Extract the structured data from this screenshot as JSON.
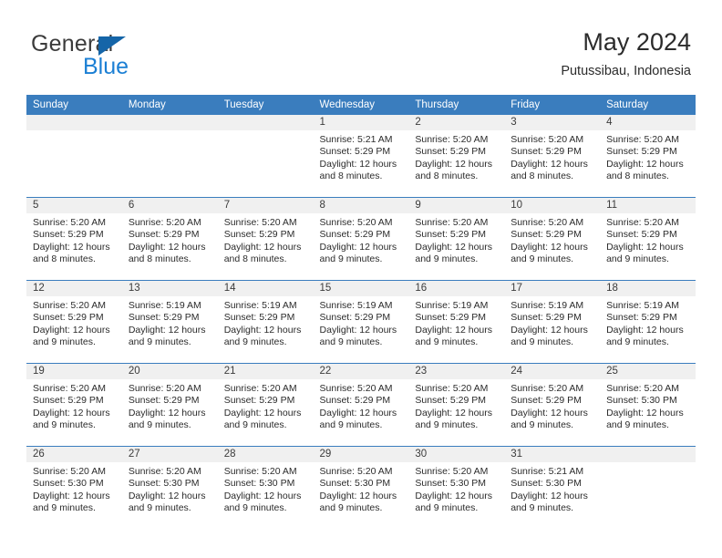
{
  "brand": {
    "name_part1": "General",
    "name_part2": "Blue",
    "triangle_icon": "triangle-icon",
    "accent_blue": "#1b7fd4",
    "logo_triangle_blue": "#1565a8"
  },
  "header": {
    "title": "May 2024",
    "subtitle": "Putussibau, Indonesia"
  },
  "colors": {
    "header_row_bg": "#3a7dbe",
    "header_row_text": "#ffffff",
    "daynum_band_bg": "#f0f0f0",
    "row_separator": "#3a7dbe",
    "body_text": "#2b2b2b"
  },
  "weekday_headers": [
    "Sunday",
    "Monday",
    "Tuesday",
    "Wednesday",
    "Thursday",
    "Friday",
    "Saturday"
  ],
  "weeks": [
    [
      {
        "day": "",
        "sunrise": "",
        "sunset": "",
        "daylight_line1": "",
        "daylight_line2": ""
      },
      {
        "day": "",
        "sunrise": "",
        "sunset": "",
        "daylight_line1": "",
        "daylight_line2": ""
      },
      {
        "day": "",
        "sunrise": "",
        "sunset": "",
        "daylight_line1": "",
        "daylight_line2": ""
      },
      {
        "day": "1",
        "sunrise": "Sunrise: 5:21 AM",
        "sunset": "Sunset: 5:29 PM",
        "daylight_line1": "Daylight: 12 hours",
        "daylight_line2": "and 8 minutes."
      },
      {
        "day": "2",
        "sunrise": "Sunrise: 5:20 AM",
        "sunset": "Sunset: 5:29 PM",
        "daylight_line1": "Daylight: 12 hours",
        "daylight_line2": "and 8 minutes."
      },
      {
        "day": "3",
        "sunrise": "Sunrise: 5:20 AM",
        "sunset": "Sunset: 5:29 PM",
        "daylight_line1": "Daylight: 12 hours",
        "daylight_line2": "and 8 minutes."
      },
      {
        "day": "4",
        "sunrise": "Sunrise: 5:20 AM",
        "sunset": "Sunset: 5:29 PM",
        "daylight_line1": "Daylight: 12 hours",
        "daylight_line2": "and 8 minutes."
      }
    ],
    [
      {
        "day": "5",
        "sunrise": "Sunrise: 5:20 AM",
        "sunset": "Sunset: 5:29 PM",
        "daylight_line1": "Daylight: 12 hours",
        "daylight_line2": "and 8 minutes."
      },
      {
        "day": "6",
        "sunrise": "Sunrise: 5:20 AM",
        "sunset": "Sunset: 5:29 PM",
        "daylight_line1": "Daylight: 12 hours",
        "daylight_line2": "and 8 minutes."
      },
      {
        "day": "7",
        "sunrise": "Sunrise: 5:20 AM",
        "sunset": "Sunset: 5:29 PM",
        "daylight_line1": "Daylight: 12 hours",
        "daylight_line2": "and 8 minutes."
      },
      {
        "day": "8",
        "sunrise": "Sunrise: 5:20 AM",
        "sunset": "Sunset: 5:29 PM",
        "daylight_line1": "Daylight: 12 hours",
        "daylight_line2": "and 9 minutes."
      },
      {
        "day": "9",
        "sunrise": "Sunrise: 5:20 AM",
        "sunset": "Sunset: 5:29 PM",
        "daylight_line1": "Daylight: 12 hours",
        "daylight_line2": "and 9 minutes."
      },
      {
        "day": "10",
        "sunrise": "Sunrise: 5:20 AM",
        "sunset": "Sunset: 5:29 PM",
        "daylight_line1": "Daylight: 12 hours",
        "daylight_line2": "and 9 minutes."
      },
      {
        "day": "11",
        "sunrise": "Sunrise: 5:20 AM",
        "sunset": "Sunset: 5:29 PM",
        "daylight_line1": "Daylight: 12 hours",
        "daylight_line2": "and 9 minutes."
      }
    ],
    [
      {
        "day": "12",
        "sunrise": "Sunrise: 5:20 AM",
        "sunset": "Sunset: 5:29 PM",
        "daylight_line1": "Daylight: 12 hours",
        "daylight_line2": "and 9 minutes."
      },
      {
        "day": "13",
        "sunrise": "Sunrise: 5:19 AM",
        "sunset": "Sunset: 5:29 PM",
        "daylight_line1": "Daylight: 12 hours",
        "daylight_line2": "and 9 minutes."
      },
      {
        "day": "14",
        "sunrise": "Sunrise: 5:19 AM",
        "sunset": "Sunset: 5:29 PM",
        "daylight_line1": "Daylight: 12 hours",
        "daylight_line2": "and 9 minutes."
      },
      {
        "day": "15",
        "sunrise": "Sunrise: 5:19 AM",
        "sunset": "Sunset: 5:29 PM",
        "daylight_line1": "Daylight: 12 hours",
        "daylight_line2": "and 9 minutes."
      },
      {
        "day": "16",
        "sunrise": "Sunrise: 5:19 AM",
        "sunset": "Sunset: 5:29 PM",
        "daylight_line1": "Daylight: 12 hours",
        "daylight_line2": "and 9 minutes."
      },
      {
        "day": "17",
        "sunrise": "Sunrise: 5:19 AM",
        "sunset": "Sunset: 5:29 PM",
        "daylight_line1": "Daylight: 12 hours",
        "daylight_line2": "and 9 minutes."
      },
      {
        "day": "18",
        "sunrise": "Sunrise: 5:19 AM",
        "sunset": "Sunset: 5:29 PM",
        "daylight_line1": "Daylight: 12 hours",
        "daylight_line2": "and 9 minutes."
      }
    ],
    [
      {
        "day": "19",
        "sunrise": "Sunrise: 5:20 AM",
        "sunset": "Sunset: 5:29 PM",
        "daylight_line1": "Daylight: 12 hours",
        "daylight_line2": "and 9 minutes."
      },
      {
        "day": "20",
        "sunrise": "Sunrise: 5:20 AM",
        "sunset": "Sunset: 5:29 PM",
        "daylight_line1": "Daylight: 12 hours",
        "daylight_line2": "and 9 minutes."
      },
      {
        "day": "21",
        "sunrise": "Sunrise: 5:20 AM",
        "sunset": "Sunset: 5:29 PM",
        "daylight_line1": "Daylight: 12 hours",
        "daylight_line2": "and 9 minutes."
      },
      {
        "day": "22",
        "sunrise": "Sunrise: 5:20 AM",
        "sunset": "Sunset: 5:29 PM",
        "daylight_line1": "Daylight: 12 hours",
        "daylight_line2": "and 9 minutes."
      },
      {
        "day": "23",
        "sunrise": "Sunrise: 5:20 AM",
        "sunset": "Sunset: 5:29 PM",
        "daylight_line1": "Daylight: 12 hours",
        "daylight_line2": "and 9 minutes."
      },
      {
        "day": "24",
        "sunrise": "Sunrise: 5:20 AM",
        "sunset": "Sunset: 5:29 PM",
        "daylight_line1": "Daylight: 12 hours",
        "daylight_line2": "and 9 minutes."
      },
      {
        "day": "25",
        "sunrise": "Sunrise: 5:20 AM",
        "sunset": "Sunset: 5:30 PM",
        "daylight_line1": "Daylight: 12 hours",
        "daylight_line2": "and 9 minutes."
      }
    ],
    [
      {
        "day": "26",
        "sunrise": "Sunrise: 5:20 AM",
        "sunset": "Sunset: 5:30 PM",
        "daylight_line1": "Daylight: 12 hours",
        "daylight_line2": "and 9 minutes."
      },
      {
        "day": "27",
        "sunrise": "Sunrise: 5:20 AM",
        "sunset": "Sunset: 5:30 PM",
        "daylight_line1": "Daylight: 12 hours",
        "daylight_line2": "and 9 minutes."
      },
      {
        "day": "28",
        "sunrise": "Sunrise: 5:20 AM",
        "sunset": "Sunset: 5:30 PM",
        "daylight_line1": "Daylight: 12 hours",
        "daylight_line2": "and 9 minutes."
      },
      {
        "day": "29",
        "sunrise": "Sunrise: 5:20 AM",
        "sunset": "Sunset: 5:30 PM",
        "daylight_line1": "Daylight: 12 hours",
        "daylight_line2": "and 9 minutes."
      },
      {
        "day": "30",
        "sunrise": "Sunrise: 5:20 AM",
        "sunset": "Sunset: 5:30 PM",
        "daylight_line1": "Daylight: 12 hours",
        "daylight_line2": "and 9 minutes."
      },
      {
        "day": "31",
        "sunrise": "Sunrise: 5:21 AM",
        "sunset": "Sunset: 5:30 PM",
        "daylight_line1": "Daylight: 12 hours",
        "daylight_line2": "and 9 minutes."
      },
      {
        "day": "",
        "sunrise": "",
        "sunset": "",
        "daylight_line1": "",
        "daylight_line2": ""
      }
    ]
  ]
}
